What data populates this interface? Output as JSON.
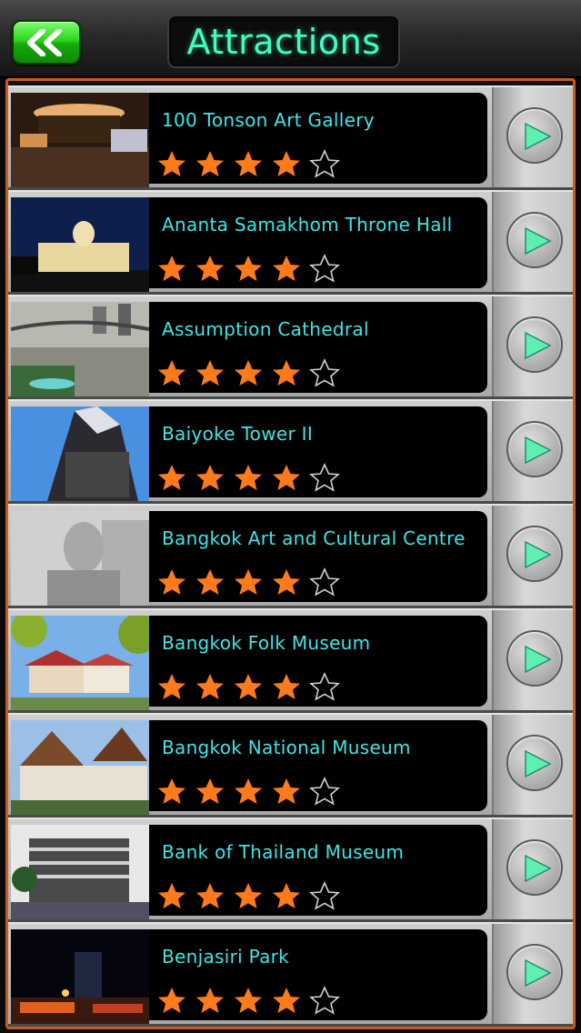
{
  "header": {
    "title": "Attractions",
    "back_icon": "double-chevron-left-icon"
  },
  "colors": {
    "accent_green": "#2fd41f",
    "title_text": "#3dffc0",
    "item_text": "#3fe6e6",
    "star_filled": "#ff7a1a",
    "frame_border": "#c85d20"
  },
  "attractions": [
    {
      "name": "100 Tonson Art Gallery",
      "rating": 4,
      "max_rating": 5
    },
    {
      "name": "Ananta Samakhom Throne Hall",
      "rating": 4,
      "max_rating": 5
    },
    {
      "name": "Assumption Cathedral",
      "rating": 4,
      "max_rating": 5
    },
    {
      "name": "Baiyoke Tower II",
      "rating": 4,
      "max_rating": 5
    },
    {
      "name": "Bangkok Art and Cultural Centre",
      "rating": 4,
      "max_rating": 5
    },
    {
      "name": "Bangkok Folk Museum",
      "rating": 4,
      "max_rating": 5
    },
    {
      "name": "Bangkok National Museum",
      "rating": 4,
      "max_rating": 5
    },
    {
      "name": "Bank of Thailand Museum",
      "rating": 4,
      "max_rating": 5
    },
    {
      "name": "Benjasiri Park",
      "rating": 4,
      "max_rating": 5
    }
  ],
  "row_action_icon": "play-arrow-icon"
}
